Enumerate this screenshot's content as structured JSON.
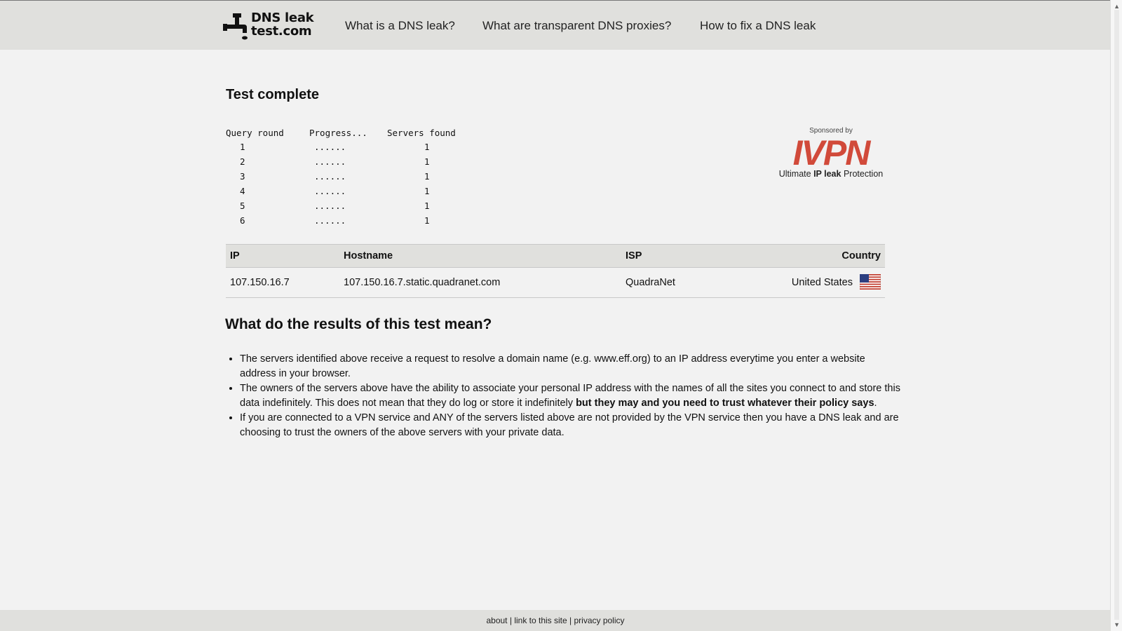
{
  "header": {
    "logo_line1": "DNS leak",
    "logo_line2": "test.com",
    "nav": [
      "What is a DNS leak?",
      "What are transparent DNS proxies?",
      "How to fix a DNS leak"
    ]
  },
  "main": {
    "title": "Test complete",
    "query_table": {
      "headers": [
        "Query round",
        "Progress...",
        "Servers found"
      ],
      "rows": [
        [
          "1",
          "......",
          "1"
        ],
        [
          "2",
          "......",
          "1"
        ],
        [
          "3",
          "......",
          "1"
        ],
        [
          "4",
          "......",
          "1"
        ],
        [
          "5",
          "......",
          "1"
        ],
        [
          "6",
          "......",
          "1"
        ]
      ]
    },
    "sponsor": {
      "label": "Sponsored by",
      "brand": "IVPN",
      "tagline_pre": "Ultimate ",
      "tagline_bold": "IP leak",
      "tagline_post": " Protection",
      "brand_color": "#d14a3a"
    },
    "results": {
      "headers": [
        "IP",
        "Hostname",
        "ISP",
        "Country"
      ],
      "rows": [
        {
          "ip": "107.150.16.7",
          "hostname": "107.150.16.7.static.quadranet.com",
          "isp": "QuadraNet",
          "country": "United States",
          "flag_icon": "us-flag-icon"
        }
      ]
    },
    "explanation": {
      "title": "What do the results of this test mean?",
      "items": [
        {
          "text": "The servers identified above receive a request to resolve a domain name (e.g. www.eff.org) to an IP address everytime you enter a website address in your browser."
        },
        {
          "text": "The owners of the servers above have the ability to associate your personal IP address with the names of all the sites you connect to and store this data indefinitely. This does not mean that they do log or store it indefinitely ",
          "bold": "but they may and you need to trust whatever their policy says",
          "tail": "."
        },
        {
          "text": "If you are connected to a VPN service and ANY of the servers listed above are not provided by the VPN service then you have a DNS leak and are choosing to trust the owners of the above servers with your private data."
        }
      ]
    }
  },
  "footer": {
    "about": "about",
    "sep1": " | ",
    "link": "link to this site",
    "sep2": " | ",
    "privacy": "privacy policy"
  },
  "colors": {
    "header_bg": "#e0e0dd",
    "page_bg": "#f2f2f2",
    "accent": "#d14a3a"
  }
}
